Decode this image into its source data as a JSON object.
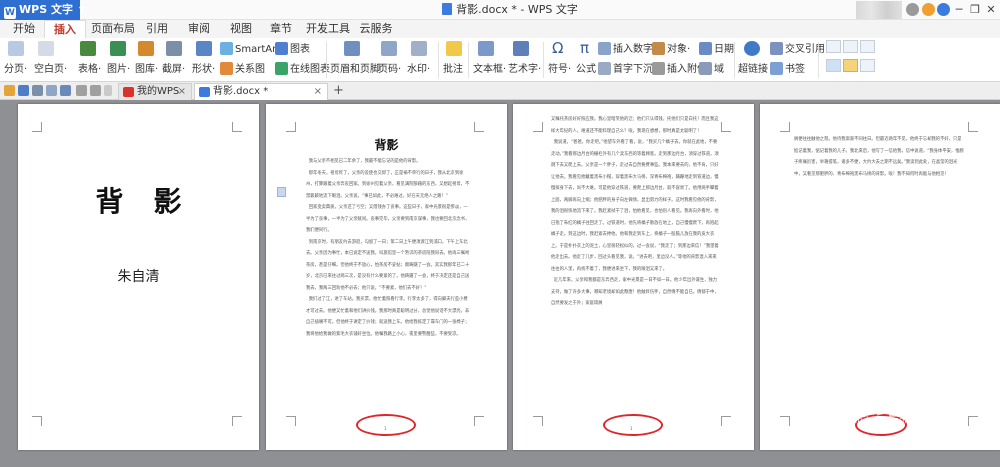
{
  "app": {
    "name": "WPS 文字",
    "logo_letter": "W",
    "document_title": "背影.docx * - WPS 文字"
  },
  "window": {
    "minimize": "─",
    "maximize": "❐",
    "close": "✕"
  },
  "menu_tabs": [
    "开始",
    "插入",
    "页面布局",
    "引用",
    "审阅",
    "视图",
    "章节",
    "开发工具",
    "云服务"
  ],
  "active_tab": "插入",
  "ribbon": {
    "page_break": "分页·",
    "blank_page": "空白页·",
    "table": "表格·",
    "picture": "图片·",
    "gallery": "图库·",
    "screenshot": "截屏·",
    "shape": "形状·",
    "smartart": "SmartArt",
    "relation_chart": "关系图",
    "chart": "图表",
    "online_chart": "在线图表",
    "header_footer": "页眉和页脚",
    "page_number": "页码·",
    "watermark": "水印·",
    "comment": "批注",
    "textbox": "文本框·",
    "wordart": "艺术字·",
    "symbol": "符号·",
    "formula": "公式",
    "insert_number": "插入数字",
    "object": "对象·",
    "date": "日期",
    "dropcap": "首字下沉",
    "attachment": "插入附件",
    "field": "域",
    "hyperlink": "超链接",
    "cross_ref": "交叉引用",
    "bookmark": "书签"
  },
  "tabs": [
    {
      "label": "我的WPS",
      "closable": true
    },
    {
      "label": "背影.docx *",
      "closable": true
    }
  ],
  "new_tab": "+",
  "cover": {
    "title": "背影",
    "author": "朱自清"
  },
  "page2": {
    "title": "背影",
    "body": "  我与父亲不相见已二年余了，我最不能忘记的是他的背影。\n  那年冬天，祖母死了，父亲的差使也交卸了，正是祸不单行的日子，我从北京到徐州，打算跟着父亲奔丧回家。到徐州见着父亲，看见满院狼藉的东西，又想起祖母，不禁簌簌地流下眼泪。父亲说，“事已如此，不必难过，好在天无绝人之路！”\n  回家变卖典质，父亲还了亏空；又借钱办了丧事。这些日子，家中光景很是惨淡，一半为了丧事，一半为了父亲赋闲。丧事完毕，父亲要到南京谋事，我也要回北京念书，我们便同行。\n  到南京时，有朋友约去游逛，勾留了一日；第二日上午便须渡江到浦口，下午上车北去。父亲因为事忙，本已说定不送我，叫旅馆里一个熟识的茶房陪我同去。他再三嘱咐茶房，甚是仔细。但他终于不放心，怕茶房不妥帖；颇踌躇了一会。其实我那年已二十岁，北京已来往过两三次，是没有什么要紧的了。他踌躇了一会，终于决定还是自己送我去。我两三回劝他不必去；他只说，“不要紧，他们去不好！”\n  我们过了江，进了车站。我买票，他忙着照看行李。行李太多了，得向脚夫行些小费才可过去。他便又忙着和他们讲价钱。我那时真是聪明过分，总觉他说话不大漂亮，非自己插嘴不可。但他终于讲定了价钱；就送我上车。他给我拣定了靠车门的一张椅子；我将他给我做的紫毛大衣铺好坐位。他嘱我路上小心，夜里要警醒些，不要受凉。"
  },
  "page3": {
    "body": "又嘱托茶房好好照应我。我心里暗笑他的迂；他们只认得钱，托他们只是白托！而且我这样大年纪的人，难道还不能料理自己么？唉，我现在想想，那时真是太聪明了！\n  我说道，“爸爸，你走吧。”他望车外看了看，说，“我买几个橘子去。你就在此地，不要走动。”我看那边月台的栅栏外有几个卖东西的等着顾客。走到那边月台，须穿过铁道，须跳下去又爬上去。父亲是一个胖子，走过去自然要费事些。我本来要去的，他不肯，只好让他去。我看见他戴着黑布小帽，穿着黑布大马褂，深青布棉袍，蹒跚地走到铁道边，慢慢探身下去，尚不大难。可是他穿过铁道，要爬上那边月台，就不容易了。他用两手攀着上面，两脚再向上缩；他肥胖的身子向左微倾，显出努力的样子。这时我看见他的背影，我的泪很快地流下来了。我赶紧拭干了泪，怕他看见，也怕别人看见。我再向外看时，他已抱了朱红的橘子往回走了。过铁道时，他先将橘子散放在地上，自己慢慢爬下，再抱起橘子走。到这边时，我赶紧去搀他。他和我走到车上，将橘子一股脑儿放在我的皮大衣上。于是扑扑衣上的泥土，心里很轻松似的，过一会说，“我走了；到那边来信！”我望着他走出去。他走了几步，回过头看见我，说，“进去吧，里边没人。”等他的背影混入来来往往的人里，再找不着了，我便进来坐下，我的眼泪又来了。\n  近几年来，父亲和我都是东奔西走，家中光景是一日不如一日。他少年出外谋生，独力支持，做了许多大事。哪知老境却如此颓唐！他触目伤怀，自然情不能自已。情郁于中，自然要发之于外；家庭琐屑"
  },
  "page4": {
    "body": "屑便往往触他之怒。他待我渐渐不同往日。但最近两年不见，他终于忘却我的不好，只是惦记着我，惦记着我的儿子。我北来后，他写了一信给我，信中说道，“我身体平安，惟膀子疼痛厉害，举箸提笔，诸多不便，大约大去之期不远矣。”我读到此处，在晶莹的泪光中，又看见那肥胖的、青布棉袍黑布马褂的背影。唉！我不知何时再能与他相见！"
  },
  "page_numbers": [
    "1",
    "1"
  ],
  "watermark": {
    "main": "Bai必经验",
    "sub": "jingyan.baidu.com"
  }
}
